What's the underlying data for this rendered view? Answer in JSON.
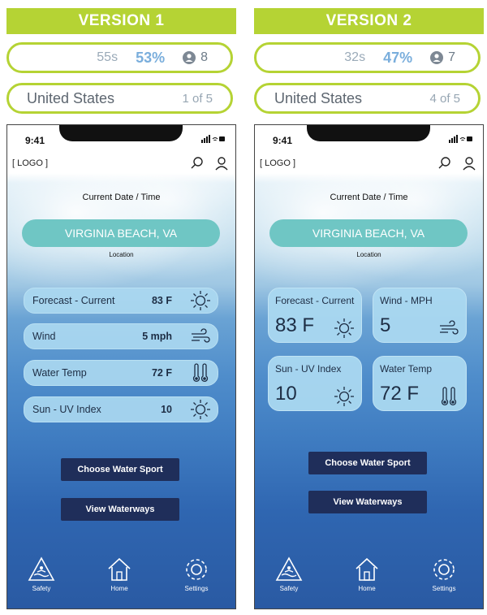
{
  "versions": [
    {
      "title": "VERSION 1",
      "stats": {
        "time": "55s",
        "percent": "53%",
        "users": "8"
      },
      "country": {
        "name": "United States",
        "count": "1 of 5"
      },
      "phone": {
        "status_time": "9:41",
        "logo": "[ LOGO ]",
        "date_label": "Current Date  /  Time",
        "location_button": "VIRGINIA BEACH, VA",
        "location_label": "Location",
        "cards": [
          {
            "label": "Forecast - Current",
            "value": "83 F",
            "icon": "sun-icon"
          },
          {
            "label": "Wind",
            "value": "5 mph",
            "icon": "wind-icon"
          },
          {
            "label": "Water Temp",
            "value": "72 F",
            "icon": "thermometer-icon"
          },
          {
            "label": "Sun - UV Index",
            "value": "10",
            "icon": "sun-icon"
          }
        ],
        "buttons": {
          "choose": "Choose Water Sport",
          "view": "View Waterways"
        },
        "nav": {
          "safety": "Safety",
          "home": "Home",
          "settings": "Settings"
        }
      }
    },
    {
      "title": "VERSION 2",
      "stats": {
        "time": "32s",
        "percent": "47%",
        "users": "7"
      },
      "country": {
        "name": "United States",
        "count": "4 of 5"
      },
      "phone": {
        "status_time": "9:41",
        "logo": "[ LOGO ]",
        "date_label": "Current Date  /  Time",
        "location_button": "VIRGINIA BEACH, VA",
        "location_label": "Location",
        "tiles": [
          {
            "label": "Forecast - Current",
            "value": "83 F",
            "icon": "sun-icon"
          },
          {
            "label": "Wind - MPH",
            "value": "5",
            "icon": "wind-icon"
          },
          {
            "label": "Sun - UV Index",
            "value": "10",
            "icon": "sun-icon"
          },
          {
            "label": "Water Temp",
            "value": "72 F",
            "icon": "thermometer-icon"
          }
        ],
        "buttons": {
          "choose": "Choose Water Sport",
          "view": "View Waterways"
        },
        "nav": {
          "safety": "Safety",
          "home": "Home",
          "settings": "Settings"
        }
      }
    }
  ],
  "colors": {
    "accent_green": "#b5d334",
    "teal": "#6fc6c4",
    "navy": "#1f2e5a",
    "card_blue": "#aad8f0"
  }
}
